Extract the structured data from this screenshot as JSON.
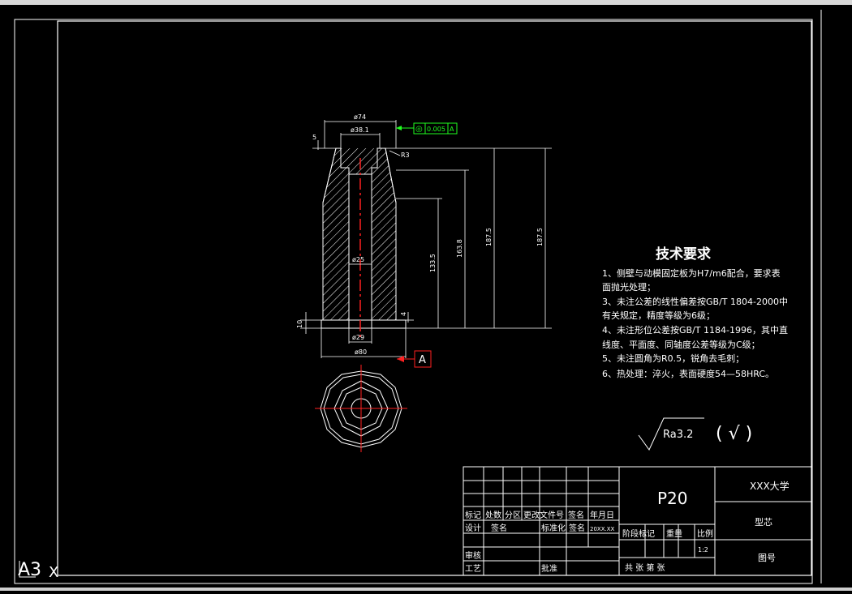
{
  "window": {
    "app": "CAD drawing viewer"
  },
  "sheet": {
    "size_label": "A3"
  },
  "part": {
    "dimensions": {
      "d74": "ø74",
      "d38": "ø38.1",
      "d25": "ø25",
      "d29": "ø29",
      "d80": "ø80",
      "r": "R3",
      "top_offset": "5",
      "h133": "133.5",
      "h163": "163.8",
      "h187a": "187.5",
      "h187b": "187.5",
      "h10": "10",
      "h4": "4"
    },
    "tolerance": {
      "symbol": "◎",
      "value": "0.005",
      "datum": "A"
    },
    "datum_label": "A"
  },
  "tech_requirements": {
    "title": "技术要求",
    "items": [
      "1、侧壁与动模固定板为H7/m6配合，要求表",
      "   面抛光处理；",
      "3、未注公差的线性偏差按GB/T 1804-2000中",
      "   有关规定，精度等级为6级；",
      "4、未注形位公差按GB/T 1184-1996，其中直",
      "   线度、平面度、同轴度公差等级为C级；",
      "5、未注圆角为R0.5，锐角去毛刺；",
      "6、热处理：淬火，表面硬度54—58HRC。"
    ]
  },
  "roughness": {
    "value": "Ra3.2",
    "note": "( √ )"
  },
  "title_block": {
    "material": "P20",
    "school": "XXX大学",
    "part_name": "型芯",
    "drawing_no": "图号",
    "row_headers": [
      "标记",
      "处数",
      "分区",
      "更改文件号",
      "签名",
      "年月日"
    ],
    "design": "设计",
    "sign": "签名",
    "standard": "标准化",
    "sign2": "签名",
    "date": "20XX.XX",
    "stage": "阶段标记",
    "weight": "重量",
    "scale": "比例",
    "scale_value": "1:2",
    "review": "审核",
    "process": "工艺",
    "approve": "批准",
    "sheets": "共  张  第  张"
  },
  "colors": {
    "background": "#000000",
    "lines": "#ffffff",
    "center": "#ff2020",
    "tolerance": "#20ff20"
  }
}
